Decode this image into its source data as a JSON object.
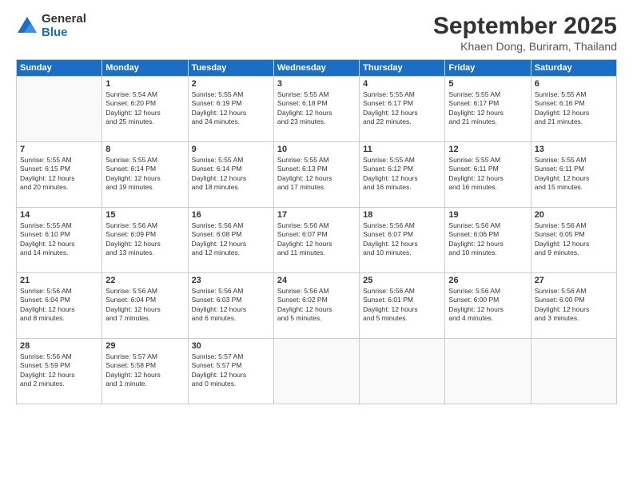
{
  "header": {
    "logo_general": "General",
    "logo_blue": "Blue",
    "title": "September 2025",
    "location": "Khaen Dong, Buriram, Thailand"
  },
  "days_of_week": [
    "Sunday",
    "Monday",
    "Tuesday",
    "Wednesday",
    "Thursday",
    "Friday",
    "Saturday"
  ],
  "weeks": [
    [
      {
        "day": "",
        "info": ""
      },
      {
        "day": "1",
        "info": "Sunrise: 5:54 AM\nSunset: 6:20 PM\nDaylight: 12 hours\nand 25 minutes."
      },
      {
        "day": "2",
        "info": "Sunrise: 5:55 AM\nSunset: 6:19 PM\nDaylight: 12 hours\nand 24 minutes."
      },
      {
        "day": "3",
        "info": "Sunrise: 5:55 AM\nSunset: 6:18 PM\nDaylight: 12 hours\nand 23 minutes."
      },
      {
        "day": "4",
        "info": "Sunrise: 5:55 AM\nSunset: 6:17 PM\nDaylight: 12 hours\nand 22 minutes."
      },
      {
        "day": "5",
        "info": "Sunrise: 5:55 AM\nSunset: 6:17 PM\nDaylight: 12 hours\nand 21 minutes."
      },
      {
        "day": "6",
        "info": "Sunrise: 5:55 AM\nSunset: 6:16 PM\nDaylight: 12 hours\nand 21 minutes."
      }
    ],
    [
      {
        "day": "7",
        "info": "Sunrise: 5:55 AM\nSunset: 6:15 PM\nDaylight: 12 hours\nand 20 minutes."
      },
      {
        "day": "8",
        "info": "Sunrise: 5:55 AM\nSunset: 6:14 PM\nDaylight: 12 hours\nand 19 minutes."
      },
      {
        "day": "9",
        "info": "Sunrise: 5:55 AM\nSunset: 6:14 PM\nDaylight: 12 hours\nand 18 minutes."
      },
      {
        "day": "10",
        "info": "Sunrise: 5:55 AM\nSunset: 6:13 PM\nDaylight: 12 hours\nand 17 minutes."
      },
      {
        "day": "11",
        "info": "Sunrise: 5:55 AM\nSunset: 6:12 PM\nDaylight: 12 hours\nand 16 minutes."
      },
      {
        "day": "12",
        "info": "Sunrise: 5:55 AM\nSunset: 6:11 PM\nDaylight: 12 hours\nand 16 minutes."
      },
      {
        "day": "13",
        "info": "Sunrise: 5:55 AM\nSunset: 6:11 PM\nDaylight: 12 hours\nand 15 minutes."
      }
    ],
    [
      {
        "day": "14",
        "info": "Sunrise: 5:55 AM\nSunset: 6:10 PM\nDaylight: 12 hours\nand 14 minutes."
      },
      {
        "day": "15",
        "info": "Sunrise: 5:56 AM\nSunset: 6:09 PM\nDaylight: 12 hours\nand 13 minutes."
      },
      {
        "day": "16",
        "info": "Sunrise: 5:56 AM\nSunset: 6:08 PM\nDaylight: 12 hours\nand 12 minutes."
      },
      {
        "day": "17",
        "info": "Sunrise: 5:56 AM\nSunset: 6:07 PM\nDaylight: 12 hours\nand 11 minutes."
      },
      {
        "day": "18",
        "info": "Sunrise: 5:56 AM\nSunset: 6:07 PM\nDaylight: 12 hours\nand 10 minutes."
      },
      {
        "day": "19",
        "info": "Sunrise: 5:56 AM\nSunset: 6:06 PM\nDaylight: 12 hours\nand 10 minutes."
      },
      {
        "day": "20",
        "info": "Sunrise: 5:56 AM\nSunset: 6:05 PM\nDaylight: 12 hours\nand 9 minutes."
      }
    ],
    [
      {
        "day": "21",
        "info": "Sunrise: 5:56 AM\nSunset: 6:04 PM\nDaylight: 12 hours\nand 8 minutes."
      },
      {
        "day": "22",
        "info": "Sunrise: 5:56 AM\nSunset: 6:04 PM\nDaylight: 12 hours\nand 7 minutes."
      },
      {
        "day": "23",
        "info": "Sunrise: 5:56 AM\nSunset: 6:03 PM\nDaylight: 12 hours\nand 6 minutes."
      },
      {
        "day": "24",
        "info": "Sunrise: 5:56 AM\nSunset: 6:02 PM\nDaylight: 12 hours\nand 5 minutes."
      },
      {
        "day": "25",
        "info": "Sunrise: 5:56 AM\nSunset: 6:01 PM\nDaylight: 12 hours\nand 5 minutes."
      },
      {
        "day": "26",
        "info": "Sunrise: 5:56 AM\nSunset: 6:00 PM\nDaylight: 12 hours\nand 4 minutes."
      },
      {
        "day": "27",
        "info": "Sunrise: 5:56 AM\nSunset: 6:00 PM\nDaylight: 12 hours\nand 3 minutes."
      }
    ],
    [
      {
        "day": "28",
        "info": "Sunrise: 5:56 AM\nSunset: 5:59 PM\nDaylight: 12 hours\nand 2 minutes."
      },
      {
        "day": "29",
        "info": "Sunrise: 5:57 AM\nSunset: 5:58 PM\nDaylight: 12 hours\nand 1 minute."
      },
      {
        "day": "30",
        "info": "Sunrise: 5:57 AM\nSunset: 5:57 PM\nDaylight: 12 hours\nand 0 minutes."
      },
      {
        "day": "",
        "info": ""
      },
      {
        "day": "",
        "info": ""
      },
      {
        "day": "",
        "info": ""
      },
      {
        "day": "",
        "info": ""
      }
    ]
  ]
}
